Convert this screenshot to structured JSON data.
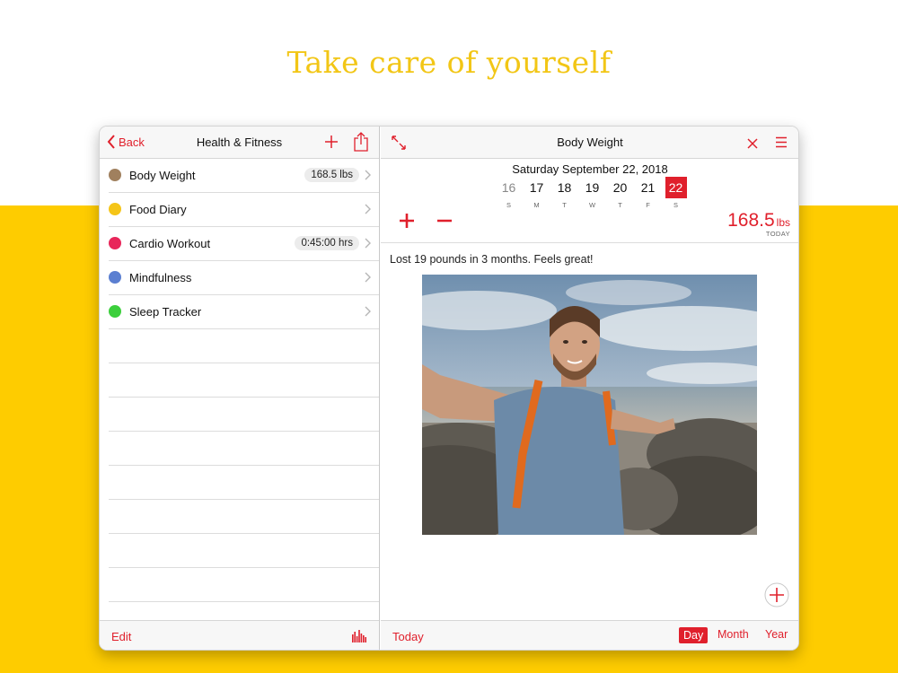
{
  "headline": "Take care of yourself",
  "colors": {
    "accent": "#e0202c",
    "band": "#fecc00",
    "headline": "#f2c616"
  },
  "left_panel": {
    "back_label": "Back",
    "title": "Health & Fitness",
    "items": [
      {
        "label": "Body Weight",
        "color": "#a0805e",
        "badge": "168.5 lbs"
      },
      {
        "label": "Food Diary",
        "color": "#f5c518",
        "badge": ""
      },
      {
        "label": "Cardio Workout",
        "color": "#e8265a",
        "badge": "0:45:00 hrs"
      },
      {
        "label": "Mindfulness",
        "color": "#5b7fd1",
        "badge": ""
      },
      {
        "label": "Sleep Tracker",
        "color": "#3ccf3c",
        "badge": ""
      }
    ],
    "edit_label": "Edit"
  },
  "right_panel": {
    "title": "Body Weight",
    "date_title": "Saturday  September 22, 2018",
    "days": [
      {
        "num": "16",
        "wk": "S"
      },
      {
        "num": "17",
        "wk": "M"
      },
      {
        "num": "18",
        "wk": "T"
      },
      {
        "num": "19",
        "wk": "W"
      },
      {
        "num": "20",
        "wk": "T"
      },
      {
        "num": "21",
        "wk": "F"
      },
      {
        "num": "22",
        "wk": "S"
      }
    ],
    "selected_day": "22",
    "weight_value": "168.5",
    "weight_unit": "lbs",
    "weight_sub": "TODAY",
    "note": "Lost 19 pounds in 3 months. Feels great!",
    "today_label": "Today",
    "segments": [
      "Day",
      "Month",
      "Year"
    ],
    "active_segment": "Day"
  }
}
